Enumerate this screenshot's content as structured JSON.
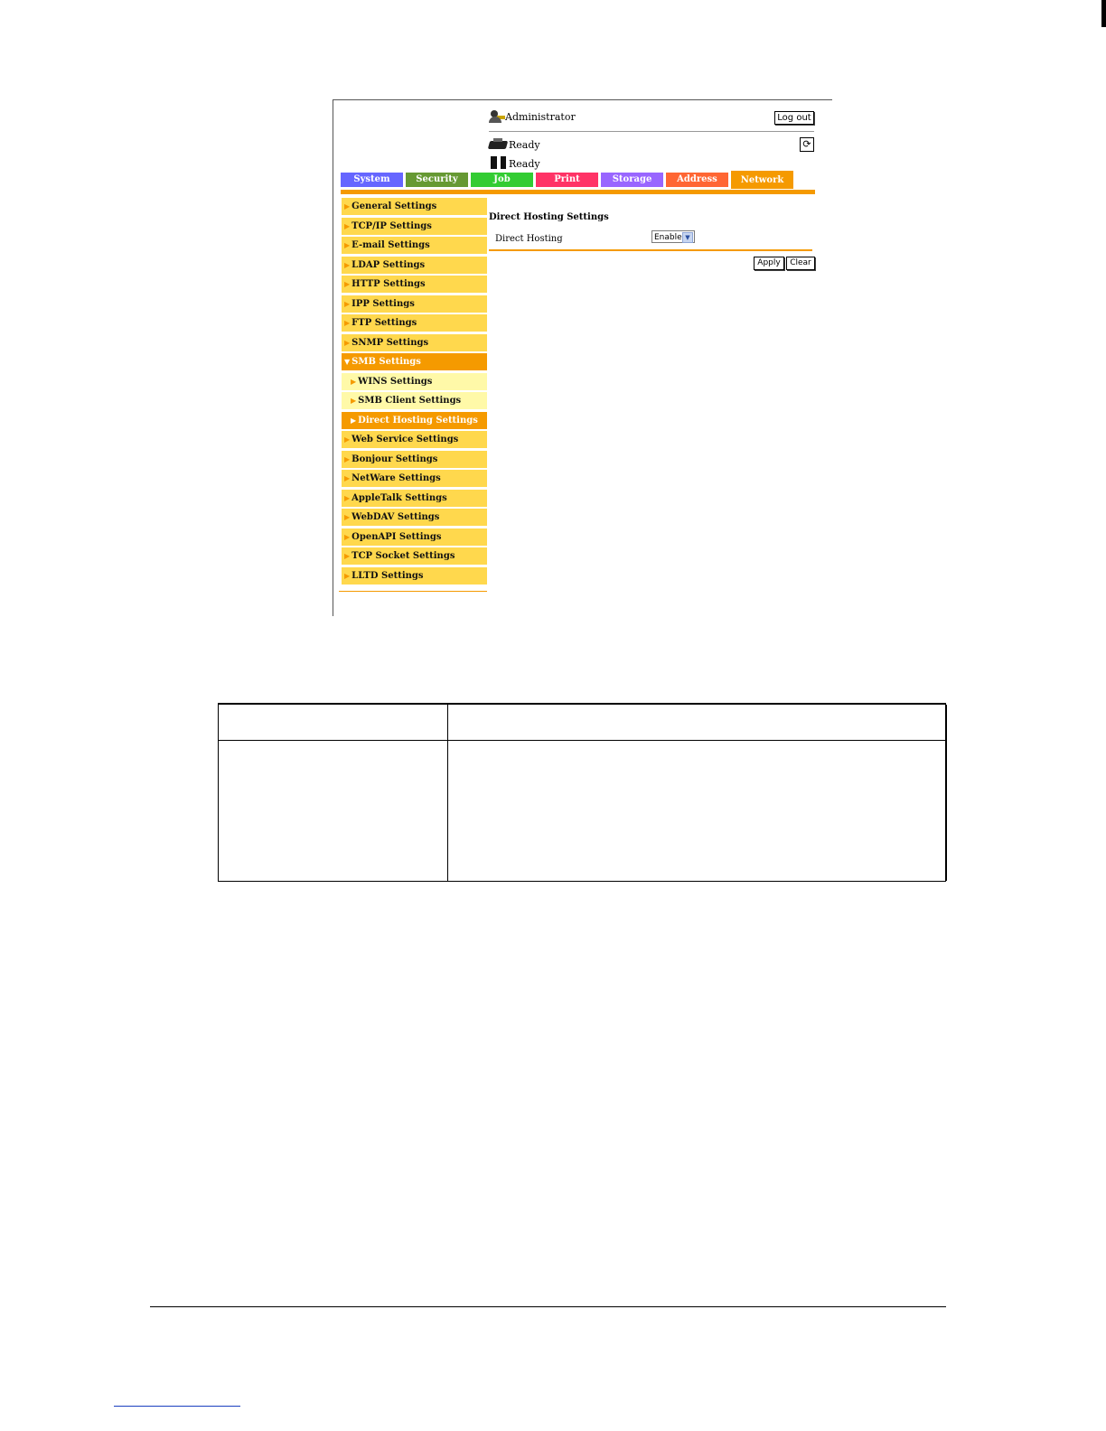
{
  "header": {
    "user_label": "Administrator",
    "logout_label": "Log out",
    "status_printer": "Ready",
    "status_scanner": "Ready",
    "refresh_icon": "refresh-icon"
  },
  "tabs": [
    {
      "label": "System",
      "color": "#6666ff"
    },
    {
      "label": "Security",
      "color": "#669933"
    },
    {
      "label": "Job",
      "color": "#33cc33"
    },
    {
      "label": "Print",
      "color": "#ff3366"
    },
    {
      "label": "Storage",
      "color": "#9966ff"
    },
    {
      "label": "Address",
      "color": "#ff6633"
    },
    {
      "label": "Network",
      "color": "#f59a00"
    }
  ],
  "sidebar": {
    "items": [
      {
        "label": "General Settings",
        "kind": "item"
      },
      {
        "label": "TCP/IP Settings",
        "kind": "item"
      },
      {
        "label": "E-mail Settings",
        "kind": "item"
      },
      {
        "label": "LDAP Settings",
        "kind": "item"
      },
      {
        "label": "HTTP Settings",
        "kind": "item"
      },
      {
        "label": "IPP Settings",
        "kind": "item"
      },
      {
        "label": "FTP Settings",
        "kind": "item"
      },
      {
        "label": "SNMP Settings",
        "kind": "item"
      },
      {
        "label": "SMB Settings",
        "kind": "open"
      },
      {
        "label": "WINS Settings",
        "kind": "sub"
      },
      {
        "label": "SMB Client Settings",
        "kind": "sub"
      },
      {
        "label": "Direct Hosting Settings",
        "kind": "selected"
      },
      {
        "label": "Web Service Settings",
        "kind": "item"
      },
      {
        "label": "Bonjour Settings",
        "kind": "item"
      },
      {
        "label": "NetWare Settings",
        "kind": "item"
      },
      {
        "label": "AppleTalk Settings",
        "kind": "item"
      },
      {
        "label": "WebDAV Settings",
        "kind": "item"
      },
      {
        "label": "OpenAPI Settings",
        "kind": "item"
      },
      {
        "label": "TCP Socket Settings",
        "kind": "item"
      },
      {
        "label": "LLTD Settings",
        "kind": "item"
      }
    ]
  },
  "content": {
    "title": "Direct Hosting Settings",
    "field_label": "Direct Hosting",
    "field_value": "Enable",
    "apply_label": "Apply",
    "clear_label": "Clear"
  }
}
